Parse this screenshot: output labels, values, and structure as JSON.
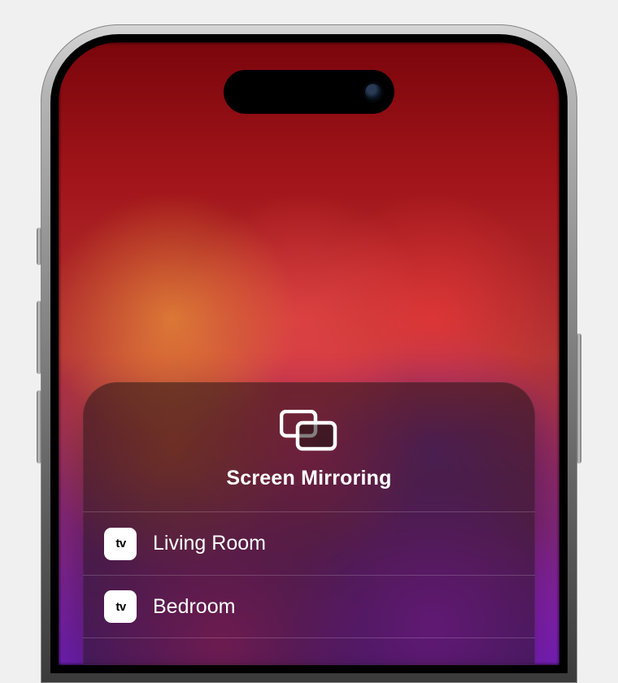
{
  "modal": {
    "title": "Screen Mirroring",
    "icon": "screen-mirroring-icon",
    "devices": [
      {
        "icon": "apple-tv-icon",
        "label": "Living Room"
      },
      {
        "icon": "apple-tv-icon",
        "label": "Bedroom"
      }
    ]
  },
  "device_icon_text": {
    "apple": "",
    "tv": "tv"
  }
}
